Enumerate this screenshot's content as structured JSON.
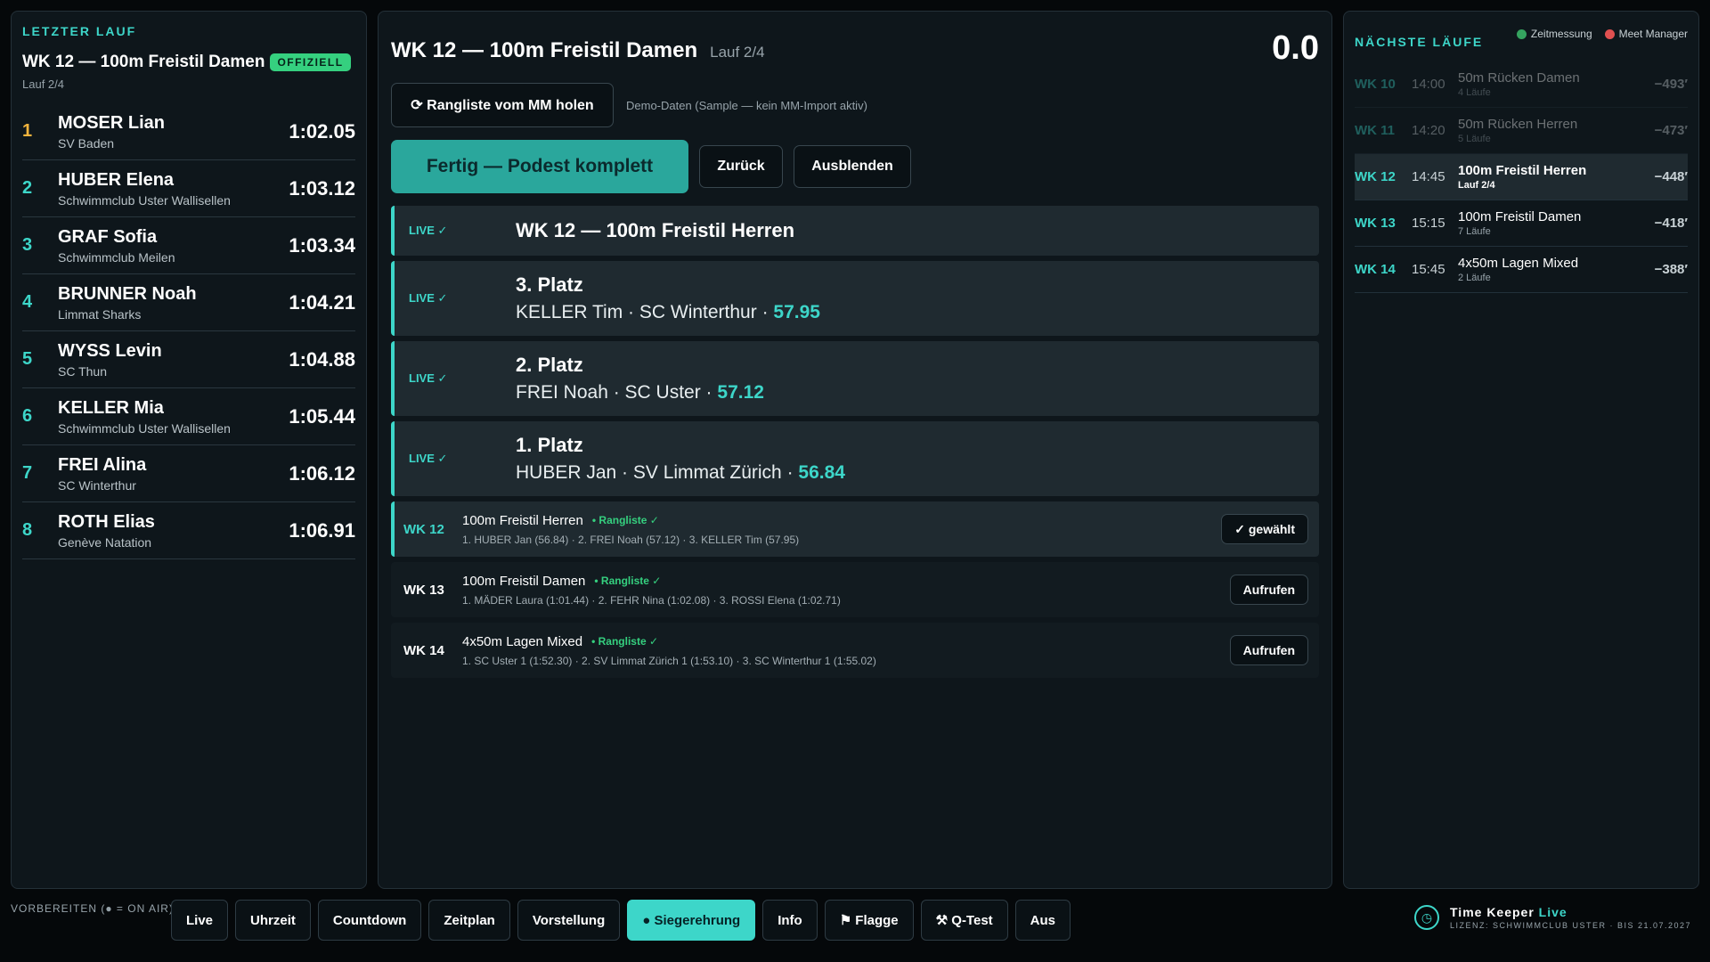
{
  "last_run": {
    "label": "LETZTER LAUF",
    "title": "WK 12 — 100m Freistil Damen",
    "badge": "OFFIZIELL",
    "subtitle": "Lauf 2/4",
    "results": [
      {
        "rank": "1",
        "name": "MOSER Lian",
        "club": "SV Baden",
        "time": "1:02.05"
      },
      {
        "rank": "2",
        "name": "HUBER Elena",
        "club": "Schwimmclub Uster Wallisellen",
        "time": "1:03.12"
      },
      {
        "rank": "3",
        "name": "GRAF Sofia",
        "club": "Schwimmclub Meilen",
        "time": "1:03.34"
      },
      {
        "rank": "4",
        "name": "BRUNNER Noah",
        "club": "Limmat Sharks",
        "time": "1:04.21"
      },
      {
        "rank": "5",
        "name": "WYSS Levin",
        "club": "SC Thun",
        "time": "1:04.88"
      },
      {
        "rank": "6",
        "name": "KELLER Mia",
        "club": "Schwimmclub Uster Wallisellen",
        "time": "1:05.44"
      },
      {
        "rank": "7",
        "name": "FREI Alina",
        "club": "SC Winterthur",
        "time": "1:06.12"
      },
      {
        "rank": "8",
        "name": "ROTH Elias",
        "club": "Genève Natation",
        "time": "1:06.91"
      }
    ]
  },
  "center": {
    "title": "WK 12 — 100m Freistil Damen",
    "lauf": "Lauf 2/4",
    "clock": "0.0",
    "mm_button": "⟳ Rangliste vom MM holen",
    "demo_note": "Demo-Daten (Sample — kein MM-Import aktiv)",
    "fertig_button": "Fertig — Podest komplett",
    "back_button": "Zurück",
    "hide_button": "Ausblenden",
    "live_tag": "LIVE ✓",
    "live_head": "WK 12 — 100m Freistil Herren",
    "places": [
      {
        "title": "3. Platz",
        "line": "KELLER Tim · SC Winterthur · ",
        "time": "57.95"
      },
      {
        "title": "2. Platz",
        "line": "FREI Noah · SC Uster · ",
        "time": "57.12"
      },
      {
        "title": "1. Platz",
        "line": "HUBER Jan · SV Limmat Zürich · ",
        "time": "56.84"
      }
    ],
    "events": [
      {
        "wk": "WK 12",
        "name": "100m Freistil Herren",
        "rl": "• Rangliste ✓",
        "results": "1. HUBER Jan (56.84)  ·  2. FREI Noah (57.12)  ·  3. KELLER Tim (57.95)",
        "button": "✓ gewählt"
      },
      {
        "wk": "WK 13",
        "name": "100m Freistil Damen",
        "rl": "• Rangliste ✓",
        "results": "1. MÄDER Laura (1:01.44)  ·  2. FEHR Nina (1:02.08)  ·  3. ROSSI Elena (1:02.71)",
        "button": "Aufrufen"
      },
      {
        "wk": "WK 14",
        "name": "4x50m Lagen Mixed",
        "rl": "• Rangliste ✓",
        "results": "1. SC Uster 1 (1:52.30)  ·  2. SV Limmat Zürich 1 (1:53.10)  ·  3. SC Winterthur 1 (1:55.02)",
        "button": "Aufrufen"
      }
    ]
  },
  "next_runs": {
    "label": "NÄCHSTE LÄUFE",
    "status": [
      {
        "label": "Zeitmessung",
        "color": "#35a35f"
      },
      {
        "label": "Meet Manager",
        "color": "#e05050"
      }
    ],
    "items": [
      {
        "wk": "WK 10",
        "time": "14:00",
        "name": "50m Rücken Damen",
        "sub": "4 Läufe",
        "eta": "−493′"
      },
      {
        "wk": "WK 11",
        "time": "14:20",
        "name": "50m Rücken Herren",
        "sub": "5 Läufe",
        "eta": "−473′"
      },
      {
        "wk": "WK 12",
        "time": "14:45",
        "name": "100m Freistil Herren",
        "sub": "Lauf 2/4",
        "eta": "−448′"
      },
      {
        "wk": "WK 13",
        "time": "15:15",
        "name": "100m Freistil Damen",
        "sub": "7 Läufe",
        "eta": "−418′"
      },
      {
        "wk": "WK 14",
        "time": "15:45",
        "name": "4x50m Lagen Mixed",
        "sub": "2 Läufe",
        "eta": "−388′"
      }
    ]
  },
  "bottom": {
    "label": "VORBEREITEN (● = ON AIR)",
    "tabs": [
      "Live",
      "Uhrzeit",
      "Countdown",
      "Zeitplan",
      "Vorstellung",
      "● Siegerehrung",
      "Info",
      "⚑ Flagge",
      "⚒ Q-Test",
      "Aus"
    ],
    "brand_name": "Time Keeper",
    "brand_live": "Live",
    "license": "LIZENZ: SCHWIMMCLUB USTER · BIS 21.07.2027"
  },
  "colors": {
    "accent": "#3dd6c9",
    "official_green": "#35d07f",
    "gold": "#f2b43d"
  },
  "icons": {
    "refresh": "refresh-icon",
    "stopwatch": "stopwatch-icon",
    "flag": "flag-icon",
    "wrench": "wrench-icon"
  }
}
